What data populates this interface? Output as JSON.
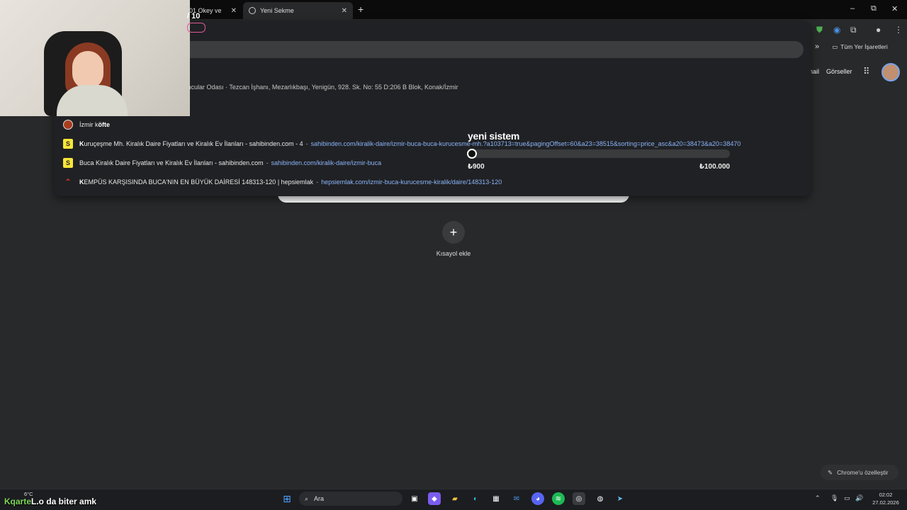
{
  "tabs": [
    {
      "label": "101 Okey ve"
    },
    {
      "label": "Yeni Sekme"
    }
  ],
  "new_tab_glyph": "+",
  "window_controls": {
    "minimize": "–",
    "maximize": "⧉",
    "close": "✕"
  },
  "bookmarks": {
    "overflow": "»",
    "all_bookmarks": "Tüm Yer İşaretleri"
  },
  "stream_overlay": {
    "score": "/ 10"
  },
  "omnibox": {
    "address_line": "ıncular Odası · Tezcan İşhanı, Mezarlıkbaşı, Yenigün, 928. Sk. No: 55 D:206 B Blok, Konak/İzmir",
    "suggestions": [
      {
        "icon": "food-icon",
        "title_pre": "İzmir k",
        "title_bold": "öfte",
        "title_post": "",
        "url": ""
      },
      {
        "icon": "sahibinden-icon",
        "title_pre": "",
        "title_bold": "K",
        "title_post": "uruçeşme Mh. Kiralık Daire Fiyatları ve Kiralık Ev İlanları - sahibinden.com - 4",
        "url": "sahibinden.com/kiralik-daire/izmir-buca-buca-kurucesme-mh.?a103713=true&pagingOffset=60&a23=38515&sorting=price_asc&a20=38473&a20=38470"
      },
      {
        "icon": "sahibinden-icon",
        "title_pre": "",
        "title_bold": "",
        "title_post": "Buca Kiralık Daire Fiyatları ve Kiralık Ev İlanları - sahibinden.com",
        "url": "sahibinden.com/kiralik-daire/izmir-buca"
      },
      {
        "icon": "hepsiemlak-icon",
        "title_pre": "",
        "title_bold": "K",
        "title_post": "EMPÜS KARŞISINDA BUCA'NIN EN BÜYÜK DAİRESİ 148313-120 | hepsiemlak",
        "url": "hepsiemlak.com/izmir-buca-kurucesme-kiralik/daire/148313-120"
      }
    ]
  },
  "price_widget": {
    "title": "yeni sistem",
    "min": "₺900",
    "max": "₺100.000",
    "level": 0.0
  },
  "google": {
    "gmail": "nail",
    "images": "Görseller",
    "add_shortcut_glyph": "+",
    "add_shortcut_label": "Kısayol ekle",
    "customize": "Chrome'u özelleştir"
  },
  "taskbar": {
    "weather": "6°C",
    "caption_prefix": "Kqarte",
    "caption": "L.o da biter amk",
    "search": "Ara",
    "time": "02:02",
    "date": "27.02.2026"
  },
  "colors": {
    "accent_link": "#8ab4f8",
    "background": "#28292a"
  }
}
